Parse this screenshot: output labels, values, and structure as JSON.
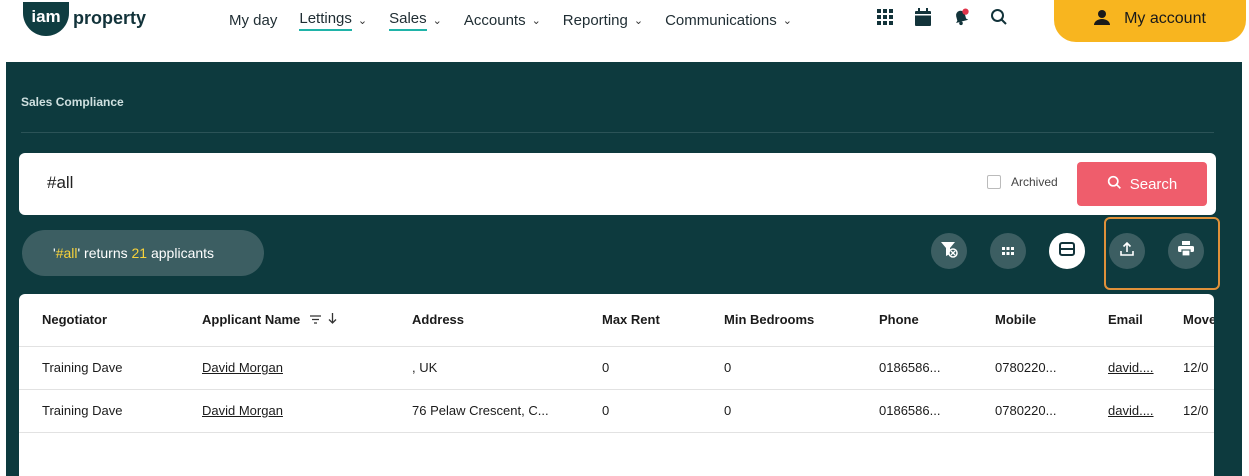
{
  "header": {
    "logo_badge": "iam",
    "logo_text": "property",
    "nav": [
      {
        "label": "My day",
        "dropdown": false,
        "active": false
      },
      {
        "label": "Lettings",
        "dropdown": true,
        "active": true
      },
      {
        "label": "Sales",
        "dropdown": true,
        "active": true
      },
      {
        "label": "Accounts",
        "dropdown": true,
        "active": false
      },
      {
        "label": "Reporting",
        "dropdown": true,
        "active": false
      },
      {
        "label": "Communications",
        "dropdown": true,
        "active": false
      }
    ],
    "icons": [
      "apps-grid-icon",
      "calendar-icon",
      "notification-bell-icon",
      "search-icon"
    ],
    "account_label": "My account"
  },
  "page": {
    "title": "Sales Compliance"
  },
  "search": {
    "value": "#all",
    "archived_label": "Archived",
    "button_label": "Search"
  },
  "results": {
    "prefix_quote_open": "'",
    "term": "#all",
    "prefix_quote_close": "' returns ",
    "count": "21",
    "suffix": " applicants"
  },
  "toolbar": {
    "buttons": [
      "clear-filter-icon",
      "grid-view-icon",
      "list-view-icon",
      "export-icon",
      "print-icon"
    ]
  },
  "table": {
    "columns": [
      "Negotiator",
      "Applicant Name",
      "Address",
      "Max Rent",
      "Min Bedrooms",
      "Phone",
      "Mobile",
      "Email",
      "Move"
    ],
    "rows": [
      [
        "Training Dave",
        "David Morgan",
        ", UK",
        "0",
        "0",
        "0186586...",
        "0780220...",
        "david....",
        "12/0"
      ],
      [
        "Training Dave",
        "David Morgan",
        "76 Pelaw Crescent, C...",
        "0",
        "0",
        "0186586...",
        "0780220...",
        "david....",
        "12/0"
      ]
    ]
  },
  "colors": {
    "hero_bg": "#0d3a3e",
    "accent_yellow": "#f8b51f",
    "search_button": "#ef5d6c",
    "highlight_box": "#e0913a"
  }
}
